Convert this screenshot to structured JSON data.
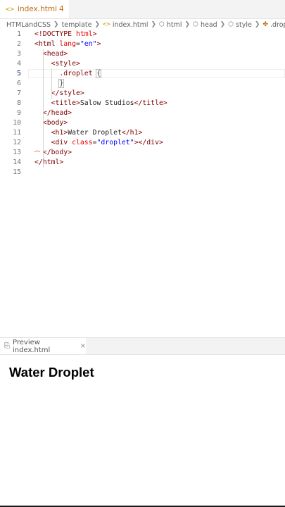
{
  "tab": {
    "icon": "code-file-icon",
    "name": "index.html",
    "problems": "4",
    "dirty": true
  },
  "breadcrumb": [
    {
      "label": "HTMLandCSS",
      "icon": ""
    },
    {
      "label": "template",
      "icon": ""
    },
    {
      "label": "index.html",
      "icon": "html-file-icon"
    },
    {
      "label": "html",
      "icon": "element-cube-icon"
    },
    {
      "label": "head",
      "icon": "element-cube-icon"
    },
    {
      "label": "style",
      "icon": "element-cube-icon"
    },
    {
      "label": ".droplet",
      "icon": "css-selector-icon"
    }
  ],
  "lines": [
    {
      "n": "1",
      "code": [
        [
          "tag",
          "<!DOCTYPE "
        ],
        [
          "attr",
          "html"
        ],
        [
          "tag",
          ">"
        ]
      ]
    },
    {
      "n": "2",
      "code": [
        [
          "tag",
          "<html "
        ],
        [
          "attr",
          "lang"
        ],
        [
          "txtc",
          "="
        ],
        [
          "str",
          "\"en\""
        ],
        [
          "tag",
          ">"
        ]
      ]
    },
    {
      "n": "3",
      "code": [
        [
          "txtc",
          "  "
        ],
        [
          "tag",
          "<head>"
        ]
      ]
    },
    {
      "n": "4",
      "code": [
        [
          "txtc",
          "    "
        ],
        [
          "tag",
          "<style>"
        ]
      ]
    },
    {
      "n": "5",
      "code": [
        [
          "txtc",
          "      "
        ],
        [
          "sel",
          ".droplet "
        ],
        [
          "brk",
          "{"
        ]
      ]
    },
    {
      "n": "6",
      "code": [
        [
          "txtc",
          "      "
        ],
        [
          "brk",
          "}"
        ]
      ]
    },
    {
      "n": "7",
      "code": [
        [
          "txtc",
          "    "
        ],
        [
          "tag",
          "</style>"
        ]
      ]
    },
    {
      "n": "8",
      "code": [
        [
          "txtc",
          "    "
        ],
        [
          "tag",
          "<title>"
        ],
        [
          "txtc",
          "Salow Studios"
        ],
        [
          "tag",
          "</title>"
        ]
      ]
    },
    {
      "n": "9",
      "code": [
        [
          "txtc",
          "  "
        ],
        [
          "tag",
          "</head>"
        ]
      ]
    },
    {
      "n": "10",
      "code": [
        [
          "txtc",
          "  "
        ],
        [
          "tag",
          "<body>"
        ]
      ]
    },
    {
      "n": "11",
      "code": [
        [
          "txtc",
          "    "
        ],
        [
          "tag",
          "<h1>"
        ],
        [
          "txtc",
          "Water Droplet"
        ],
        [
          "tag",
          "</h1>"
        ]
      ]
    },
    {
      "n": "12",
      "code": [
        [
          "txtc",
          "    "
        ],
        [
          "tag",
          "<div "
        ],
        [
          "attr",
          "class"
        ],
        [
          "txtc",
          "="
        ],
        [
          "str",
          "\"droplet\""
        ],
        [
          "tag",
          "></div>"
        ]
      ]
    },
    {
      "n": "13",
      "code": [
        [
          "txtc",
          "  "
        ],
        [
          "tag",
          "</body>"
        ]
      ]
    },
    {
      "n": "14",
      "code": [
        [
          "tag",
          "</html>"
        ]
      ]
    },
    {
      "n": "15",
      "code": []
    }
  ],
  "active_line": "5",
  "preview": {
    "tab_label": "Preview index.html",
    "icon": "preview-icon",
    "close": "×",
    "heading": "Water Droplet"
  }
}
